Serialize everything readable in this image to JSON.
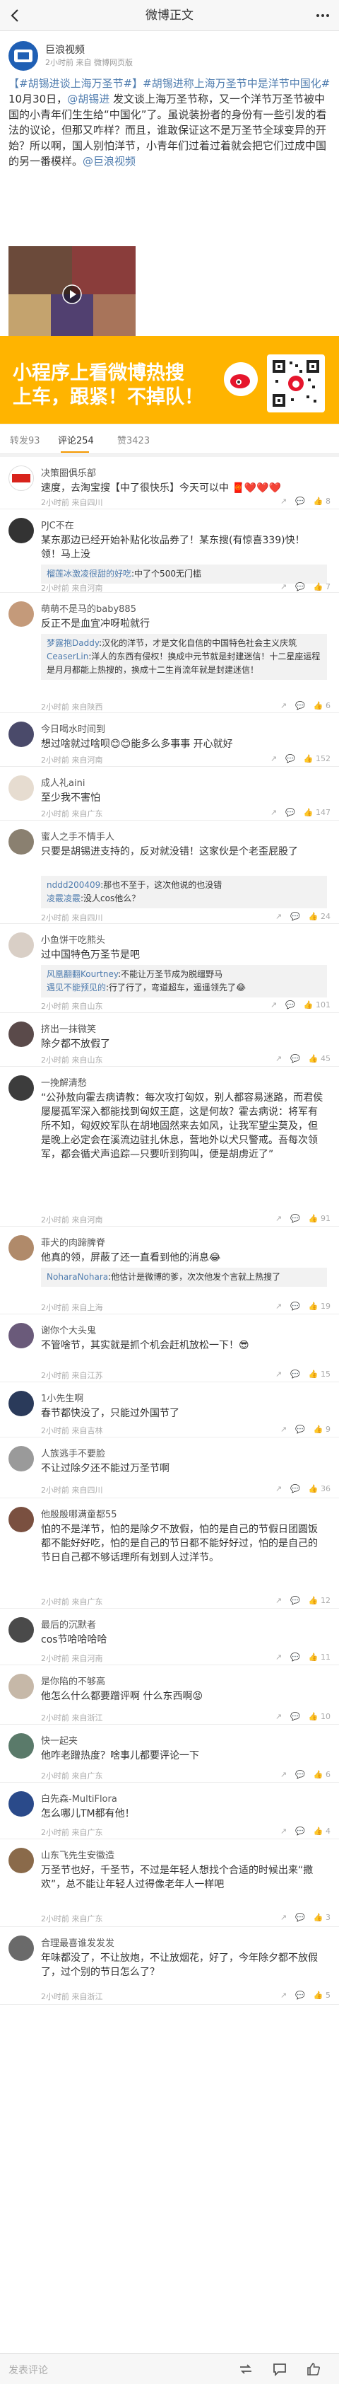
{
  "navbar": {
    "title": "微博正文"
  },
  "post": {
    "author": "巨浪视频",
    "meta": "2小时前 来自 微博网页版",
    "text_hashtag1": "【#胡锡进谈上海万圣节#】",
    "text_hashtag2": "#胡锡进称上海万圣节中是洋节中国化#",
    "text_body1": " 10月30日，",
    "text_mention1": "@胡锡进",
    "text_body2": " 发文谈上海万圣节称，又一个洋节万圣节被中国的小青年们生生给“中国化”了。虽说装扮者的身份有一些引发的看法的议论，但那又咋样？而且，谁敢保证这不是万圣节全球变异的开始？所以啊，国人别怕洋节，小青年们过着过着就会把它们过成中国的另一番模样。",
    "text_mention2": "@巨浪视频"
  },
  "ad": {
    "line1": "小程序上看微博热搜",
    "line2": "上车，跟紧！不掉队！"
  },
  "tabs": {
    "repost": "转发93",
    "comment": "评论254",
    "like": "赞3423"
  },
  "comments": [
    {
      "user": "决策圈俱乐部",
      "text": "速度，去淘宝搜【中了很快乐】今天可以中",
      "hearts": "❤️❤️❤️",
      "time": "2小时前 来自四川",
      "likes": "8"
    },
    {
      "user": "PJC不在",
      "text": "某东那边已经开始补贴化妆品券了！某东搜(有惊喜339)快！领！马上没",
      "reply_user": "榴莲冰激凌很甜的好吃",
      "reply_text": ":中了个500无门槛",
      "time": "2小时前 来自河南",
      "likes": "7"
    },
    {
      "user": "萌萌不是马的baby885",
      "text": "反正不是血宜冲呀啦就行",
      "reply_user": "梦露抱Daddy",
      "reply_text": ":汉化的洋节，才是文化自信的中国特色社会主义庆筑",
      "reply_user2": "CeaserLin",
      "reply_text2": ":洋人的东西有侵权！换成中元节就是封建迷信！十二星座运程是月月都能上热搜的，换成十二生肖流年就是封建迷信！",
      "time": "2小时前 来自陕西",
      "likes": "6"
    },
    {
      "user": "今日喝水时间到",
      "text": "想过啥就过啥呗😊😊能多么多事事 开心就好",
      "time": "2小时前 来自河南",
      "likes": "152"
    },
    {
      "user": "成人礼aini",
      "text": "至少我不害怕",
      "time": "2小时前 来自广东",
      "likes": "147"
    },
    {
      "user": "蜜人之手不情手人",
      "text": "只要是胡锡进支持的，反对就没错！这家伙是个老歪屁股了",
      "reply_user": "nddd200409",
      "reply_text": ":那也不至于，这次他说的也没错",
      "reply_user2": "凌霰凌霰",
      "reply_text2": ":没人cos他么？",
      "time": "2小时前 来自四川",
      "likes": "24"
    },
    {
      "user": "小鱼饼干吃熊头",
      "text": "过中国特色万圣节是吧",
      "reply_user": "风凰翻翻Kourtney",
      "reply_text": ":不能让万圣节成为脱缰野马",
      "reply_user2": "遇见不能预见的",
      "reply_text2": ":行了行了，弯道超车，遥遥领先了😂",
      "time": "2小时前 来自山东",
      "likes": "101"
    },
    {
      "user": "挤出一抹微笑",
      "text": "除夕都不放假了",
      "time": "2小时前 来自山东",
      "likes": "45"
    },
    {
      "user": "一挽解清愁",
      "text": "“公孙敖向霍去病请教：每次攻打匈奴，别人都容易迷路，而君侯屡屡孤军深入都能找到匈奴王庭，这是何故？霍去病说：将军有所不知，匈奴姣军队在胡地固然来去如风，让我军望尘莫及，但是晚上必定会在溪流边驻扎休息，营地外以犬只警戒。吾每次领军，都会循犬声追踪—只要听到狗叫，便是胡虏近了”",
      "time": "2小时前 来自河南",
      "likes": "91"
    },
    {
      "user": "菲犬的肉蹄脾脊",
      "text": "他真的领，屏蔽了还一直看到他的消息😂",
      "reply_user": "NoharaNohara",
      "reply_text": ":他估计是微博的爹，次次他发个言就上热搜了",
      "time": "2小时前 来自上海",
      "likes": "19"
    },
    {
      "user": "谢你个大头鬼",
      "text": "不管啥节，其实就是抓个机会赶机放松一下！😎",
      "time": "2小时前 来自江苏",
      "likes": "15"
    },
    {
      "user": "1小先生啊",
      "text": "春节都快没了，只能过外国节了",
      "time": "2小时前 来自吉林",
      "likes": "9"
    },
    {
      "user": "人族逃手不要脸",
      "text": "不让过除夕还不能过万圣节啊",
      "time": "2小时前 来自四川",
      "likes": "36"
    },
    {
      "user": "他殷殷哪满童都55",
      "text": "怕的不是洋节，怕的是除夕不放假，怕的是自己的节假日团圆饭都不能好好吃，怕的是自己的节日都不能好好过，怕的是自己的节日自己都不够话理所有划到人过洋节。",
      "time": "2小时前 来自广东",
      "likes": "12"
    },
    {
      "user": "最后的沉默者",
      "text": "cos节哈哈哈哈",
      "time": "2小时前 来自河南",
      "likes": "11"
    },
    {
      "user": "是你陷的不够高",
      "text": "他怎么什么都要蹭评啊 什么东西啊😡",
      "time": "2小时前 来自浙江",
      "likes": "10"
    },
    {
      "user": "快一起夹",
      "text": "他咋老蹭热度？啥事儿都要评论一下",
      "time": "2小时前 来自广东",
      "likes": "6"
    },
    {
      "user": "白先森-MultiFlora",
      "text": "怎么哪儿TM都有他！",
      "time": "2小时前 来自广东",
      "likes": "4"
    },
    {
      "user": "山东飞先生安徽造",
      "text": "万圣节也好，千圣节，不过是年轻人想找个合适的时候出来“撒欢”，总不能让年轻人过得像老年人一样吧",
      "time": "2小时前 来自广东",
      "likes": "3"
    },
    {
      "user": "合理最喜谁发发发",
      "text": "年味都没了，不让放炮，不让放烟花，好了，今年除夕都不放假了，过个别的节日怎么了？",
      "time": "2小时前 来自浙江",
      "likes": "5"
    }
  ],
  "bottom": {
    "input_placeholder": "发表评论"
  }
}
